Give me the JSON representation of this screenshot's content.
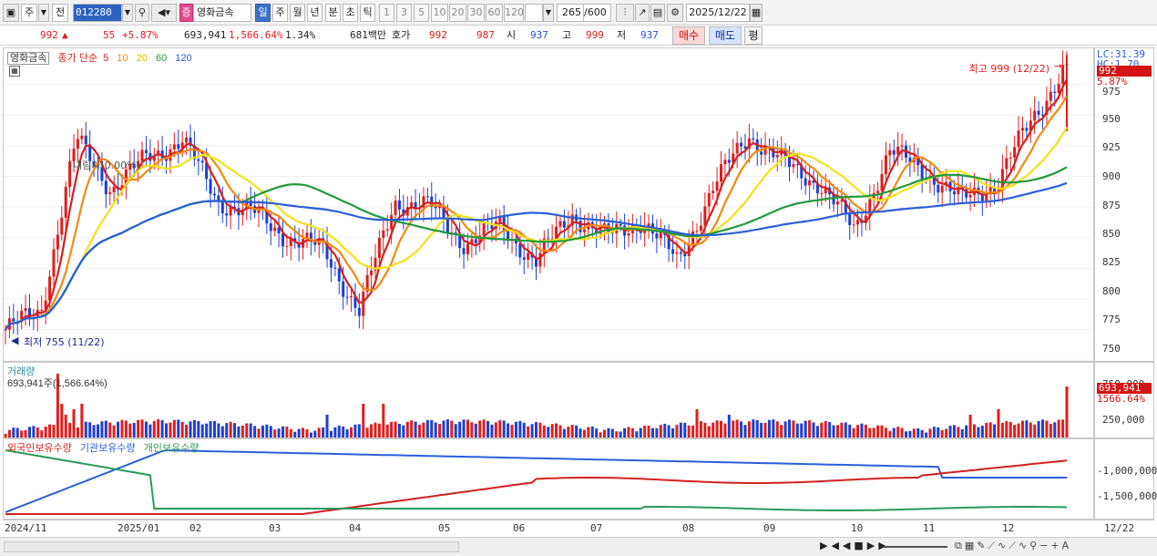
{
  "toolbar": {
    "mode_a": "주",
    "mode_b": "전",
    "code": "012280",
    "stock_badge": "증",
    "stock_name": "영화금속",
    "periods": [
      "일",
      "주",
      "월",
      "년",
      "분",
      "초",
      "틱"
    ],
    "minutes": [
      "1",
      "3",
      "5",
      "10",
      "20",
      "30",
      "60",
      "120"
    ],
    "count": "265",
    "count_total": "/600",
    "date": "2025/12/22"
  },
  "quote": {
    "price": "992",
    "arrow": "▲",
    "change": "55",
    "change_pct": "+5.87%",
    "volume": "693,941",
    "volume_ratio": "1,566.64%",
    "turnover": "1.34%",
    "amount": "681백만",
    "hoga_label": "호가",
    "ask": "992",
    "bid": "987",
    "open_label": "시",
    "open": "937",
    "high_label": "고",
    "high": "999",
    "low_label": "저",
    "low": "937",
    "buy_label": "매수",
    "sell_label": "매도",
    "eval_label": "평"
  },
  "price_pane": {
    "name_label": "영화금속",
    "ma_label": "종가 단순",
    "ma_periods": [
      "5",
      "10",
      "20",
      "60",
      "120"
    ],
    "ma_colors": [
      "#d42020",
      "#f08a10",
      "#f2e21a",
      "#1f9a3a",
      "#2a5fd8"
    ],
    "lc_label": "LC:31.39",
    "hc_label": "HC:1.70",
    "current_price_tag": "992",
    "current_pct_tag": "5.87%",
    "high_annotation": "최고 999 (12/22)",
    "low_annotation": "최저 755 (11/22)",
    "mid_annotation": "내림차(0.00%)",
    "y_ticks": [
      "975",
      "950",
      "925",
      "900",
      "875",
      "850",
      "825",
      "800",
      "775",
      "750"
    ]
  },
  "volume_pane": {
    "title": "거래량",
    "value_label": "693,941주(1,566.64%)",
    "y_ticks": [
      "750,000",
      "250,000"
    ],
    "tag_value": "693,941",
    "tag_pct": "1566.64%"
  },
  "holder_pane": {
    "legend": [
      "외국인보유수량",
      "기관보유수량",
      "개인보유수량"
    ],
    "legend_colors": [
      "#d42020",
      "#2a5fd8",
      "#2a9a5a"
    ],
    "y_ticks": [
      "-1,000,000",
      "-1,500,000"
    ]
  },
  "x_axis": [
    "2024/11",
    "2025/01",
    "02",
    "03",
    "04",
    "05",
    "06",
    "07",
    "08",
    "09",
    "10",
    "11",
    "12",
    "12/22"
  ],
  "chart_data": {
    "type": "candlestick",
    "title": "영화금속",
    "y_range": [
      745,
      1000
    ],
    "close_points": [
      [
        "2024/11",
        775
      ],
      [
        "2024/11 late",
        790
      ],
      [
        "2024/12 early",
        930
      ],
      [
        "2024/12 mid",
        890
      ],
      [
        "2025/01",
        915
      ],
      [
        "2025/01 mid",
        930
      ],
      [
        "02",
        880
      ],
      [
        "02 mid",
        870
      ],
      [
        "03",
        850
      ],
      [
        "03 mid",
        840
      ],
      [
        "04",
        790
      ],
      [
        "04 mid",
        880
      ],
      [
        "04 late",
        875
      ],
      [
        "05",
        845
      ],
      [
        "05 mid",
        860
      ],
      [
        "06",
        830
      ],
      [
        "06 mid",
        870
      ],
      [
        "07",
        850
      ],
      [
        "07 mid",
        865
      ],
      [
        "08",
        830
      ],
      [
        "08 mid",
        890
      ],
      [
        "09",
        935
      ],
      [
        "09 mid",
        910
      ],
      [
        "10",
        895
      ],
      [
        "10 mid",
        855
      ],
      [
        "10 late",
        920
      ],
      [
        "11",
        905
      ],
      [
        "11 mid",
        880
      ],
      [
        "12",
        895
      ],
      [
        "12 mid",
        945
      ],
      [
        "12/22",
        992
      ]
    ],
    "high": 999,
    "high_date": "12/22",
    "low": 755,
    "low_date": "11/22",
    "volume_max_label": "693,941"
  }
}
